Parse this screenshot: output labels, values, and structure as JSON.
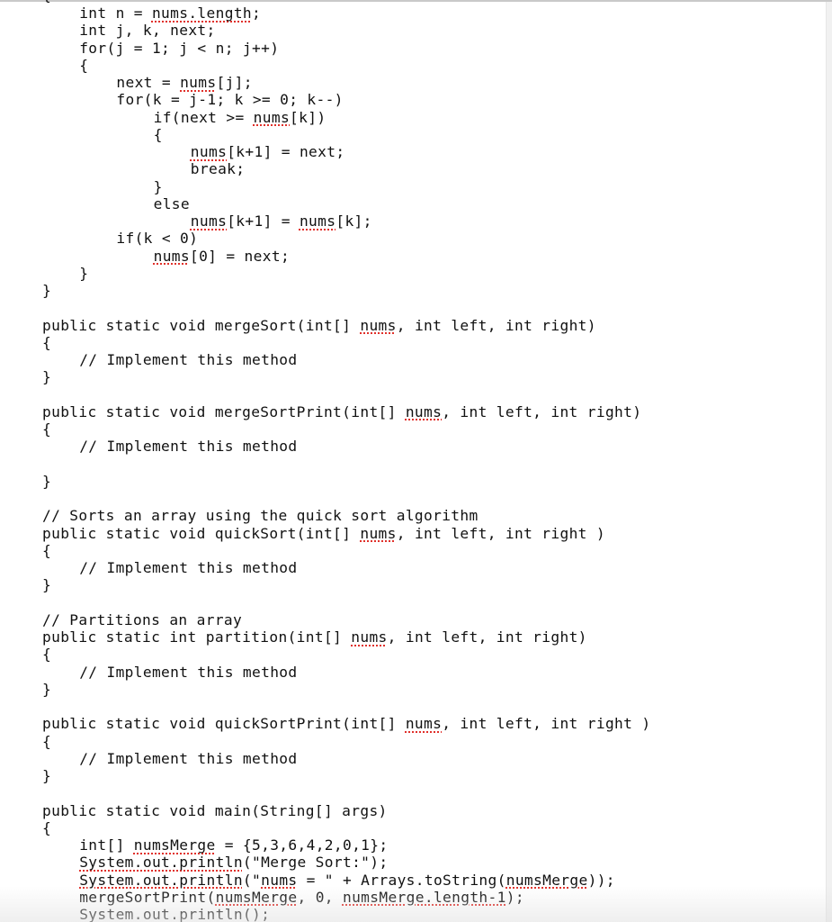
{
  "editor": {
    "squiggle_color": "#e0302a",
    "text_color": "#111111",
    "indent_unit": 4,
    "top_partial_glyph": "{",
    "lines": [
      {
        "indent": 4,
        "segments": [
          {
            "t": "int n = "
          },
          {
            "t": "nums.length",
            "sq": true
          },
          {
            "t": ";"
          }
        ]
      },
      {
        "indent": 4,
        "segments": [
          {
            "t": "int j, k, next;"
          }
        ]
      },
      {
        "indent": 4,
        "segments": [
          {
            "t": "for(j = 1; j < n; j++)"
          }
        ]
      },
      {
        "indent": 4,
        "segments": [
          {
            "t": "{"
          }
        ]
      },
      {
        "indent": 8,
        "segments": [
          {
            "t": "next = "
          },
          {
            "t": "nums",
            "sq": true
          },
          {
            "t": "[j];"
          }
        ]
      },
      {
        "indent": 8,
        "segments": [
          {
            "t": "for(k = j-1; k >= 0; k--)"
          }
        ]
      },
      {
        "indent": 12,
        "segments": [
          {
            "t": "if(next >= "
          },
          {
            "t": "nums",
            "sq": true
          },
          {
            "t": "[k])"
          }
        ]
      },
      {
        "indent": 12,
        "segments": [
          {
            "t": "{"
          }
        ]
      },
      {
        "indent": 16,
        "segments": [
          {
            "t": "nums",
            "sq": true
          },
          {
            "t": "[k+1] = next;"
          }
        ]
      },
      {
        "indent": 16,
        "segments": [
          {
            "t": "break;"
          }
        ]
      },
      {
        "indent": 12,
        "segments": [
          {
            "t": "}"
          }
        ]
      },
      {
        "indent": 12,
        "segments": [
          {
            "t": "else"
          }
        ]
      },
      {
        "indent": 16,
        "segments": [
          {
            "t": "nums",
            "sq": true
          },
          {
            "t": "[k+1] = "
          },
          {
            "t": "nums",
            "sq": true
          },
          {
            "t": "[k];"
          }
        ]
      },
      {
        "indent": 8,
        "segments": [
          {
            "t": "if(k < 0)"
          }
        ]
      },
      {
        "indent": 12,
        "segments": [
          {
            "t": "nums",
            "sq": true
          },
          {
            "t": "[0] = next;"
          }
        ]
      },
      {
        "indent": 4,
        "segments": [
          {
            "t": "}"
          }
        ]
      },
      {
        "indent": 0,
        "segments": [
          {
            "t": "}"
          }
        ]
      },
      {
        "indent": 0,
        "segments": []
      },
      {
        "indent": 0,
        "segments": [
          {
            "t": "public static void mergeSort(int[] "
          },
          {
            "t": "nums",
            "sq": true
          },
          {
            "t": ", int left, int right)"
          }
        ]
      },
      {
        "indent": 0,
        "segments": [
          {
            "t": "{"
          }
        ]
      },
      {
        "indent": 4,
        "segments": [
          {
            "t": "// Implement this method"
          }
        ]
      },
      {
        "indent": 0,
        "segments": [
          {
            "t": "}"
          }
        ]
      },
      {
        "indent": 0,
        "segments": []
      },
      {
        "indent": 0,
        "segments": [
          {
            "t": "public static void mergeSortPrint(int[] "
          },
          {
            "t": "nums",
            "sq": true
          },
          {
            "t": ", int left, int right)"
          }
        ]
      },
      {
        "indent": 0,
        "segments": [
          {
            "t": "{"
          }
        ]
      },
      {
        "indent": 4,
        "segments": [
          {
            "t": "// Implement this method"
          }
        ]
      },
      {
        "indent": 0,
        "segments": []
      },
      {
        "indent": 0,
        "segments": [
          {
            "t": "}"
          }
        ]
      },
      {
        "indent": 0,
        "segments": []
      },
      {
        "indent": 0,
        "segments": [
          {
            "t": "// Sorts an array using the quick sort algorithm"
          }
        ]
      },
      {
        "indent": 0,
        "segments": [
          {
            "t": "public static void quickSort(int[] "
          },
          {
            "t": "nums",
            "sq": true
          },
          {
            "t": ", int left, int right )"
          }
        ]
      },
      {
        "indent": 0,
        "segments": [
          {
            "t": "{"
          }
        ]
      },
      {
        "indent": 4,
        "segments": [
          {
            "t": "// Implement this method"
          }
        ]
      },
      {
        "indent": 0,
        "segments": [
          {
            "t": "}"
          }
        ]
      },
      {
        "indent": 0,
        "segments": []
      },
      {
        "indent": 0,
        "segments": [
          {
            "t": "// Partitions an array"
          }
        ]
      },
      {
        "indent": 0,
        "segments": [
          {
            "t": "public static int partition(int[] "
          },
          {
            "t": "nums",
            "sq": true
          },
          {
            "t": ", int left, int right)"
          }
        ]
      },
      {
        "indent": 0,
        "segments": [
          {
            "t": "{"
          }
        ]
      },
      {
        "indent": 4,
        "segments": [
          {
            "t": "// Implement this method"
          }
        ]
      },
      {
        "indent": 0,
        "segments": [
          {
            "t": "}"
          }
        ]
      },
      {
        "indent": 0,
        "segments": []
      },
      {
        "indent": 0,
        "segments": [
          {
            "t": "public static void quickSortPrint(int[] "
          },
          {
            "t": "nums",
            "sq": true
          },
          {
            "t": ", int left, int right )"
          }
        ]
      },
      {
        "indent": 0,
        "segments": [
          {
            "t": "{"
          }
        ]
      },
      {
        "indent": 4,
        "segments": [
          {
            "t": "// Implement this method"
          }
        ]
      },
      {
        "indent": 0,
        "segments": [
          {
            "t": "}"
          }
        ]
      },
      {
        "indent": 0,
        "segments": []
      },
      {
        "indent": 0,
        "segments": [
          {
            "t": "public static void main(String[] args)"
          }
        ]
      },
      {
        "indent": 0,
        "segments": [
          {
            "t": "{"
          }
        ]
      },
      {
        "indent": 4,
        "segments": [
          {
            "t": "int[] "
          },
          {
            "t": "numsMerge",
            "sq": true
          },
          {
            "t": " = {5,3,6,4,2,0,1};"
          }
        ]
      },
      {
        "indent": 4,
        "segments": [
          {
            "t": "System.out.println",
            "sq": true
          },
          {
            "t": "(\"Merge Sort:\");"
          }
        ]
      },
      {
        "indent": 4,
        "segments": [
          {
            "t": "System.out.println",
            "sq": true
          },
          {
            "t": "(\""
          },
          {
            "t": "nums",
            "sq": true
          },
          {
            "t": " = \" + Arrays.toString("
          },
          {
            "t": "numsMerge",
            "sq": true
          },
          {
            "t": "));"
          }
        ]
      },
      {
        "indent": 4,
        "segments": [
          {
            "t": "mergeSortPrint("
          },
          {
            "t": "numsMerge",
            "sq": true
          },
          {
            "t": ", 0, "
          },
          {
            "t": "numsMerge.length-1",
            "sq": true
          },
          {
            "t": ");"
          }
        ]
      },
      {
        "indent": 4,
        "segments": [
          {
            "t": "System.out.println",
            "sq": true
          },
          {
            "t": "();"
          }
        ]
      }
    ]
  }
}
